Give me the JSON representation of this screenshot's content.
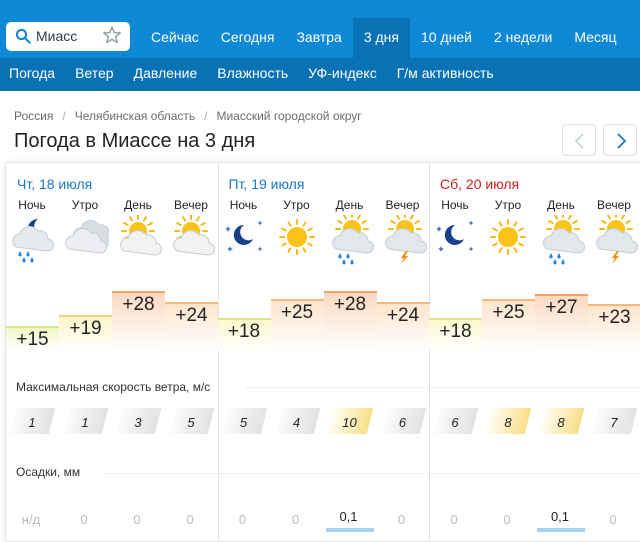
{
  "search": {
    "city": "Миасс"
  },
  "tabs": [
    {
      "label": "Сейчас",
      "active": false
    },
    {
      "label": "Сегодня",
      "active": false
    },
    {
      "label": "Завтра",
      "active": false
    },
    {
      "label": "3 дня",
      "active": true
    },
    {
      "label": "10 дней",
      "active": false
    },
    {
      "label": "2 недели",
      "active": false
    },
    {
      "label": "Месяц",
      "active": false
    }
  ],
  "subtabs": [
    "Погода",
    "Ветер",
    "Давление",
    "Влажность",
    "УФ-индекс",
    "Г/м активность"
  ],
  "breadcrumb": [
    "Россия",
    "Челябинская область",
    "Миасский городской округ"
  ],
  "page_title": "Погода в Миассе на 3 дня",
  "periods": [
    "Ночь",
    "Утро",
    "День",
    "Вечер"
  ],
  "days": [
    {
      "label": "Чт, 18 июля",
      "weekend": false
    },
    {
      "label": "Пт, 19 июля",
      "weekend": false
    },
    {
      "label": "Сб, 20 июля",
      "weekend": true
    }
  ],
  "slots": [
    {
      "day": 0,
      "period": 0,
      "icon": "night-cloud-rain-icon",
      "temp": "+15",
      "wind": "1",
      "precip": "н/д"
    },
    {
      "day": 0,
      "period": 1,
      "icon": "cloudy-icon",
      "temp": "+19",
      "wind": "1",
      "precip": "0"
    },
    {
      "day": 0,
      "period": 2,
      "icon": "sun-cloud-icon",
      "temp": "+28",
      "wind": "3",
      "precip": "0"
    },
    {
      "day": 0,
      "period": 3,
      "icon": "sun-cloud-icon",
      "temp": "+24",
      "wind": "5",
      "precip": "0"
    },
    {
      "day": 1,
      "period": 0,
      "icon": "clear-night-icon",
      "temp": "+18",
      "wind": "5",
      "precip": "0"
    },
    {
      "day": 1,
      "period": 1,
      "icon": "sun-icon",
      "temp": "+25",
      "wind": "4",
      "precip": "0"
    },
    {
      "day": 1,
      "period": 2,
      "icon": "sun-cloud-rain-icon",
      "temp": "+28",
      "wind": "10",
      "precip": "0,1"
    },
    {
      "day": 1,
      "period": 3,
      "icon": "sun-cloud-thunder-icon",
      "temp": "+24",
      "wind": "6",
      "precip": "0"
    },
    {
      "day": 2,
      "period": 0,
      "icon": "clear-night-icon",
      "temp": "+18",
      "wind": "6",
      "precip": "0"
    },
    {
      "day": 2,
      "period": 1,
      "icon": "sun-icon",
      "temp": "+25",
      "wind": "8",
      "precip": "0"
    },
    {
      "day": 2,
      "period": 2,
      "icon": "sun-cloud-rain-icon",
      "temp": "+27",
      "wind": "8",
      "precip": "0,1"
    },
    {
      "day": 2,
      "period": 3,
      "icon": "sun-cloud-thunder-icon",
      "temp": "+23",
      "wind": "7",
      "precip": "0"
    }
  ],
  "wind_label": "Максимальная скорость ветра, м/с",
  "precip_label": "Осадки, мм",
  "colors": {
    "nav": "#0f88d6",
    "nav_active": "#0972b4",
    "weekday": "#1a78c8",
    "weekend": "#d21e1e"
  }
}
